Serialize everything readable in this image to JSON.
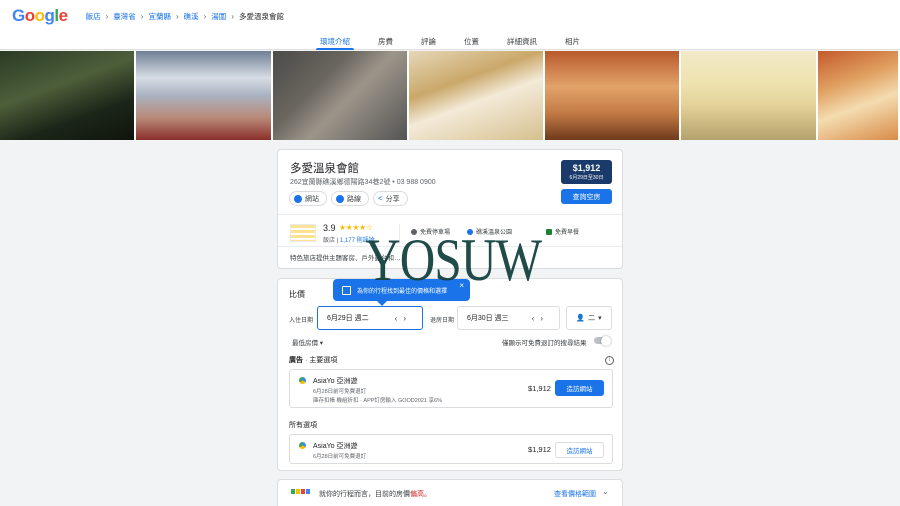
{
  "logo": {
    "letters": [
      {
        "char": "G",
        "color": "#4285f4"
      },
      {
        "char": "o",
        "color": "#ea4335"
      },
      {
        "char": "o",
        "color": "#fbbc04"
      },
      {
        "char": "g",
        "color": "#4285f4"
      },
      {
        "char": "l",
        "color": "#34a853"
      },
      {
        "char": "e",
        "color": "#ea4335"
      }
    ]
  },
  "breadcrumbs": [
    "飯店",
    "臺灣省",
    "宜蘭縣",
    "礁溪",
    "湯圍",
    "多愛溫泉會館"
  ],
  "tabs": [
    {
      "label": "環境介紹",
      "active": true
    },
    {
      "label": "房費",
      "active": false
    },
    {
      "label": "評論",
      "active": false
    },
    {
      "label": "位置",
      "active": false
    },
    {
      "label": "詳細資訊",
      "active": false
    },
    {
      "label": "相片",
      "active": false
    }
  ],
  "hotel": {
    "name": "多愛溫泉會館",
    "address": "262宜蘭縣礁溪鄉德陽路34巷2號 • 03 988 0900",
    "chips": {
      "website": "網站",
      "route": "路線",
      "share": "分享"
    },
    "price": "$1,912",
    "price_dates": "6月29日至30日",
    "availability_button": "查詢空房",
    "rating": "3.9",
    "stars": "★★★★☆",
    "rating_class": "飯店",
    "reviews": "1,177 則評論",
    "amenities": [
      "免費停車場",
      "礁溪溫泉公園",
      "免費早餐"
    ],
    "description": "特色旅店提供主題客房、戶外露台和…"
  },
  "watermark": "YOSUW",
  "compare": {
    "title": "比價",
    "tooltip": "為你的行程找到最佳的價格和選擇",
    "checkin_label": "入住日期",
    "checkin_value": "6月29日 週二",
    "checkout_label": "退房日期",
    "checkout_value": "6月30日 週三",
    "guests_value": "二",
    "sort": "最低房價 ▾",
    "toggle_label": "僅顯示可免費退訂的搜尋結果",
    "sponsored_tag": "廣告",
    "sponsored_title": " · 主要選項",
    "all_options_title": "所有選項",
    "offers": [
      {
        "name": "AsiaYo 亞洲遊",
        "sub": "6月28日前可免費退訂",
        "sub2": "庫存扣帳 機組折扣 · APP訂房輸入 GOOD2021 享6%",
        "price": "$1,912",
        "button": "造訪網站"
      },
      {
        "name": "AsiaYo 亞洲遊",
        "sub": "6月28日前可免費退訂",
        "price": "$1,912",
        "button": "造訪網站"
      }
    ]
  },
  "bottom": {
    "text_prefix": "就你的行程而言，目前的房價",
    "text_highlight": "偏高。",
    "link": "查看價格範圍"
  },
  "colors": {
    "accent": "#1a73e8",
    "price_box": "#1a3a6b",
    "star": "#fbbc04",
    "watermark": "#14423f"
  }
}
